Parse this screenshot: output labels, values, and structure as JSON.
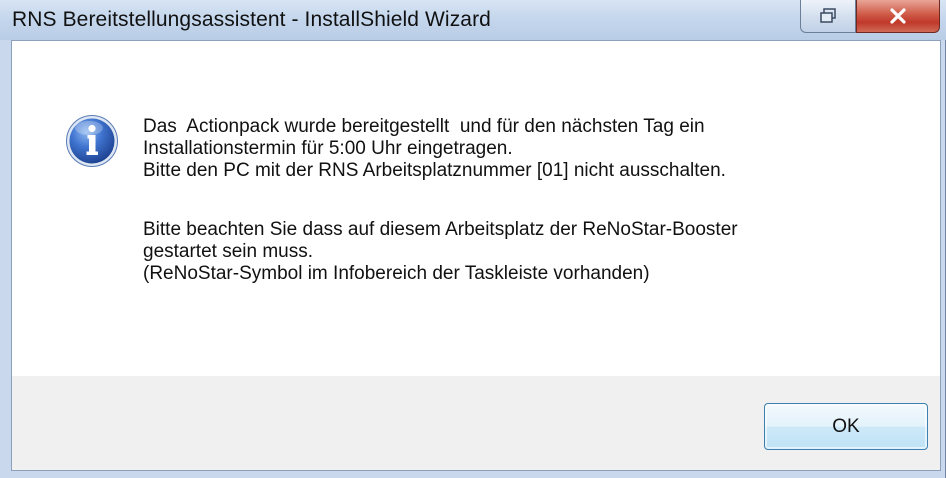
{
  "window": {
    "title": "RNS Bereitstellungsassistent - InstallShield Wizard",
    "restore_icon": "restore-icon",
    "close_icon": "close-icon"
  },
  "message": {
    "icon": "info-icon",
    "lines": [
      "Das  Actionpack wurde bereitgestellt  und für den nächsten Tag ein",
      "Installationstermin für 5:00 Uhr eingetragen.",
      "Bitte den PC mit der RNS Arbeitsplatznummer [01] nicht ausschalten.",
      "Bitte beachten Sie dass auf diesem Arbeitsplatz der ReNoStar-Booster",
      "gestartet sein muss.",
      "(ReNoStar-Symbol im Infobereich der Taskleiste vorhanden)"
    ]
  },
  "buttons": {
    "ok_label": "OK"
  },
  "colors": {
    "titlebar": "#c4d6ec",
    "close_button": "#c0392b",
    "ok_border": "#3c7fb1",
    "info_icon": "#2f5fb3",
    "footer": "#f0f0f0"
  }
}
